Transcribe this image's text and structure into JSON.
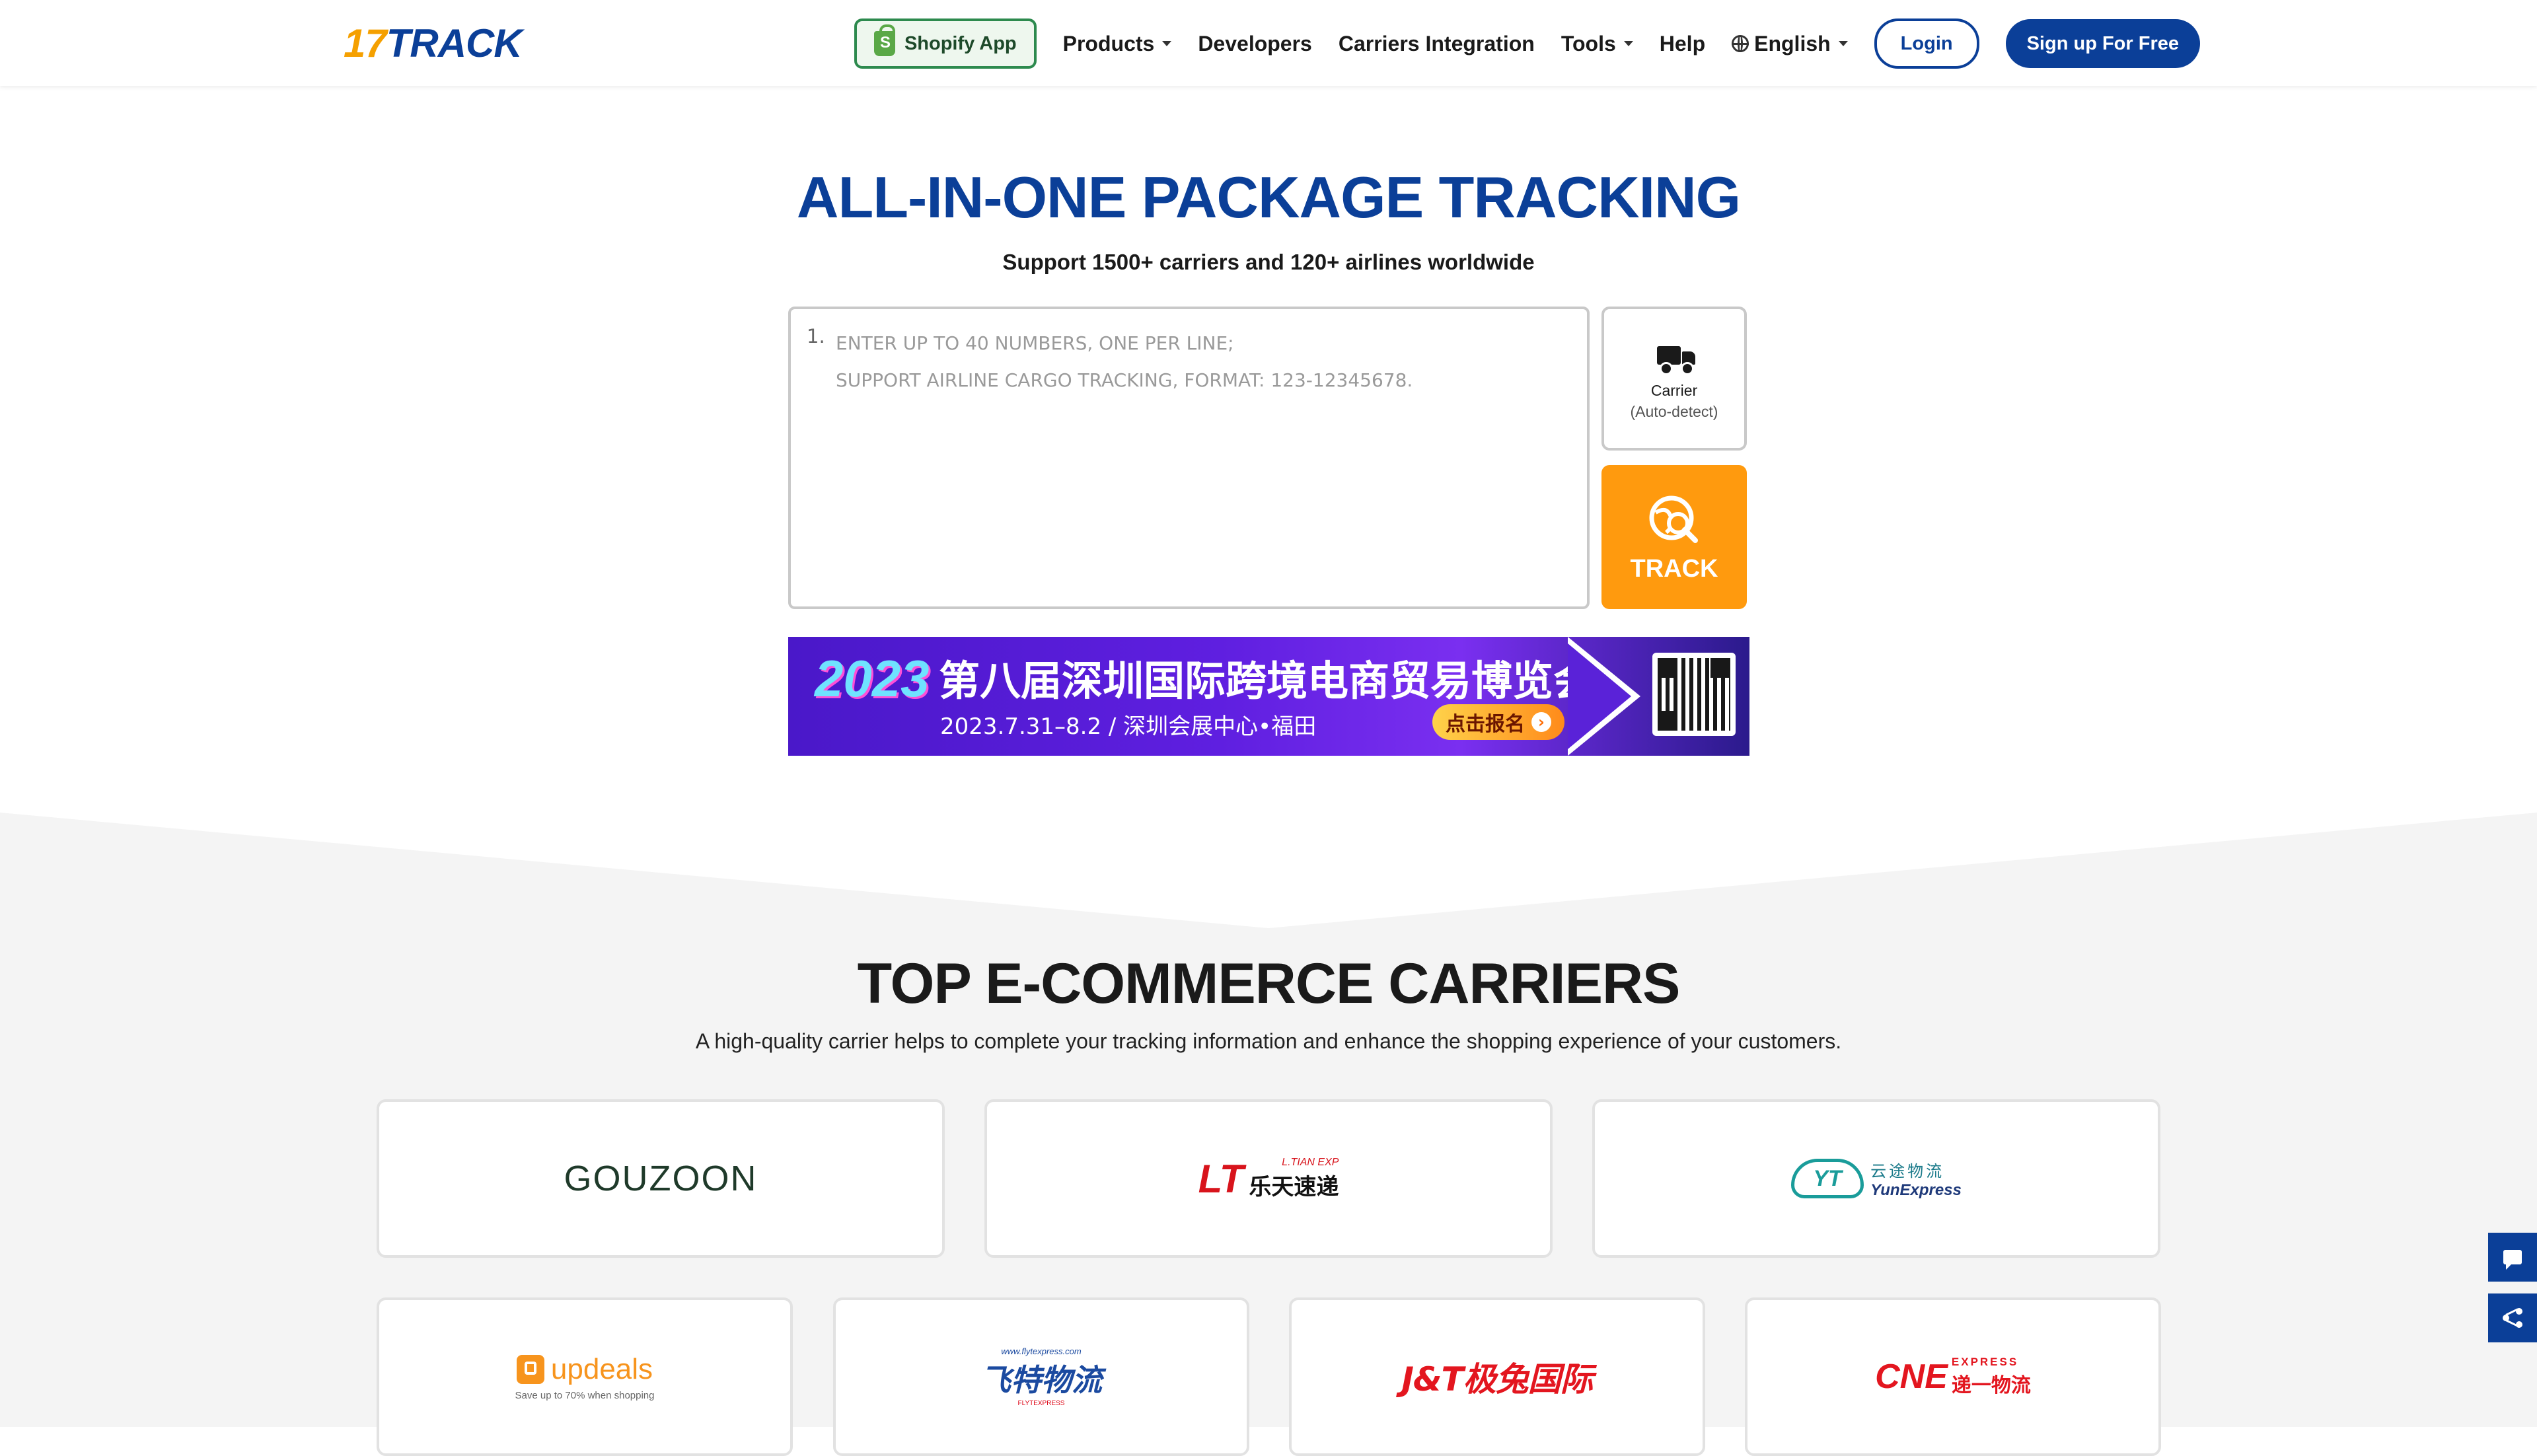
{
  "header": {
    "logo_num": "17",
    "logo_word": "TRACK",
    "shopify_label": "Shopify App",
    "nav": {
      "products": "Products",
      "developers": "Developers",
      "carriers_integration": "Carriers Integration",
      "tools": "Tools",
      "help": "Help",
      "language": "English"
    },
    "login": "Login",
    "signup": "Sign up For Free"
  },
  "hero": {
    "title": "ALL-IN-ONE PACKAGE TRACKING",
    "subtitle": "Support 1500+ carriers and 120+ airlines worldwide",
    "input": {
      "line_number": "1.",
      "placeholder": "ENTER UP TO 40 NUMBERS, ONE PER LINE;\nSUPPORT AIRLINE CARGO TRACKING, FORMAT: 123-12345678."
    },
    "carrier": {
      "label": "Carrier",
      "sub": "(Auto-detect)"
    },
    "track_label": "TRACK"
  },
  "banner": {
    "year": "2023",
    "title": "第八届深圳国际跨境电商贸易博览会",
    "date_venue": "2023.7.31–8.2   /   深圳会展中心•福田",
    "cta": "点击报名"
  },
  "carriers": {
    "title": "TOP E-COMMERCE CARRIERS",
    "subtitle": "A high-quality carrier helps to complete your tracking information and enhance the shopping experience of your customers.",
    "items": [
      {
        "name": "GOUZOON"
      },
      {
        "mark": "LT",
        "en": "L.TIAN EXP",
        "cn": "乐天速递"
      },
      {
        "cn": "云途物流",
        "en": "YunExpress"
      },
      {
        "name": "updeals",
        "tagline": "Save up to 70% when shopping"
      },
      {
        "url": "www.flytexpress.com",
        "cn": "飞特物流",
        "tiny": "FLYTEXPRESS"
      },
      {
        "name": "J&T极兔国际"
      },
      {
        "big": "CNE",
        "en": "EXPRESS",
        "cn": "递一物流"
      }
    ]
  },
  "colors": {
    "brand_blue": "#0b3f98",
    "brand_orange": "#ff9a0e",
    "shopify_green": "#2d8a4e"
  },
  "icons": [
    "shopify-bag-icon",
    "caret-down-icon",
    "globe-icon",
    "truck-icon",
    "track-search-icon",
    "chat-icon",
    "share-icon"
  ]
}
